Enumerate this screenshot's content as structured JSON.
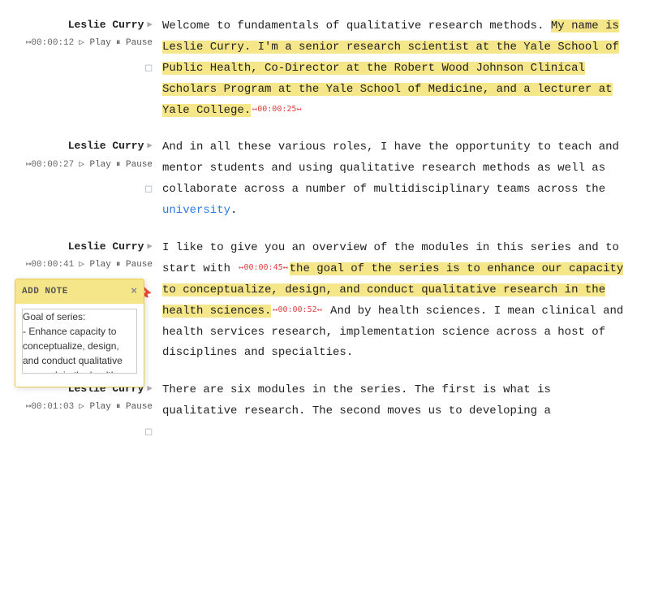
{
  "segments": [
    {
      "id": "seg1",
      "speaker": "Leslie Curry",
      "timestamp": "00:00:12",
      "has_note": false,
      "transcript": [
        {
          "type": "text",
          "content": "Welcome to fundamentals of qualitative research methods. "
        },
        {
          "type": "highlight-yellow",
          "content": "My name is Leslie Curry. I'm a senior research scientist at the Yale School of Public Health, Co-Director at the Robert Wood Johnson Clinical Scholars Program at the Yale School of Medicine, and a lecturer at Yale College."
        },
        {
          "type": "inline-ts",
          "content": "00:00:25"
        }
      ]
    },
    {
      "id": "seg2",
      "speaker": "Leslie Curry",
      "timestamp": "00:00:27",
      "has_note": false,
      "transcript": [
        {
          "type": "text",
          "content": "And in all these various roles, I have the opportunity to teach and mentor students and using qualitative research methods as well as collaborate across a number of multidisciplinary teams across the "
        },
        {
          "type": "link",
          "content": "university"
        },
        {
          "type": "text",
          "content": "."
        }
      ]
    },
    {
      "id": "seg3",
      "speaker": "Leslie Curry",
      "timestamp": "00:00:41",
      "has_note": true,
      "note_title": "ADD NOTE",
      "note_content": "Goal of series:\n- Enhance capacity to conceptualize, design, and conduct qualitative research in the health sciences",
      "transcript": [
        {
          "type": "text",
          "content": "I like to give you an overview of the modules in this series and to start with "
        },
        {
          "type": "inline-ts",
          "content": "00:00:45"
        },
        {
          "type": "highlight-yellow",
          "content": "the goal of the series is to enhance our capacity to conceptualize, design, and conduct qualitative research in the health sciences."
        },
        {
          "type": "inline-ts",
          "content": "00:00:52"
        },
        {
          "type": "text",
          "content": " And by health sciences. I mean clinical and health services research, implementation science across a host of disciplines and specialties."
        }
      ]
    },
    {
      "id": "seg4",
      "speaker": "Leslie Curry",
      "timestamp": "00:01:03",
      "has_note": false,
      "transcript": [
        {
          "type": "text",
          "content": "There are six modules in the series. The first is what is qualitative research. The second moves us to developing a"
        }
      ]
    }
  ],
  "labels": {
    "play": "Play",
    "pause": "Pause",
    "add_note_title": "ADD NOTE"
  }
}
